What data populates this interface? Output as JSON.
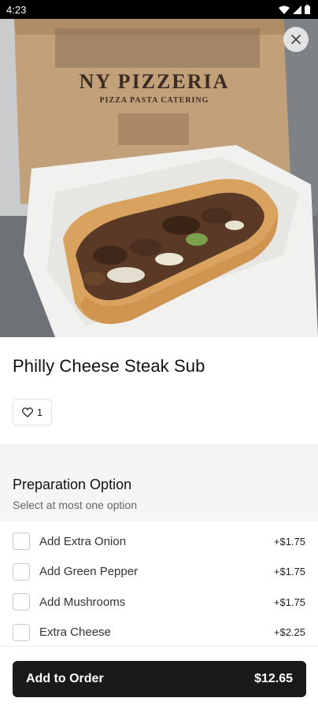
{
  "status_bar": {
    "time": "4:23"
  },
  "item": {
    "title": "Philly Cheese Steak Sub",
    "likes": "1",
    "image_text": {
      "line1": "NY PIZZERIA",
      "line2": "PIZZA  PASTA  CATERING"
    }
  },
  "preparation": {
    "title": "Preparation Option",
    "subtitle": "Select at most one option",
    "options": [
      {
        "label": "Add Extra Onion",
        "price": "+$1.75"
      },
      {
        "label": "Add Green Pepper",
        "price": "+$1.75"
      },
      {
        "label": "Add Mushrooms",
        "price": "+$1.75"
      },
      {
        "label": "Extra Cheese",
        "price": "+$2.25"
      }
    ]
  },
  "cta": {
    "label": "Add to Order",
    "price": "$12.65"
  },
  "icons": {
    "close": "close-icon",
    "heart": "heart-icon",
    "wifi": "wifi-icon",
    "signal": "signal-icon",
    "battery": "battery-icon"
  },
  "colors": {
    "cta_bg": "#1a1a1a",
    "section_bg": "#f5f5f5"
  }
}
